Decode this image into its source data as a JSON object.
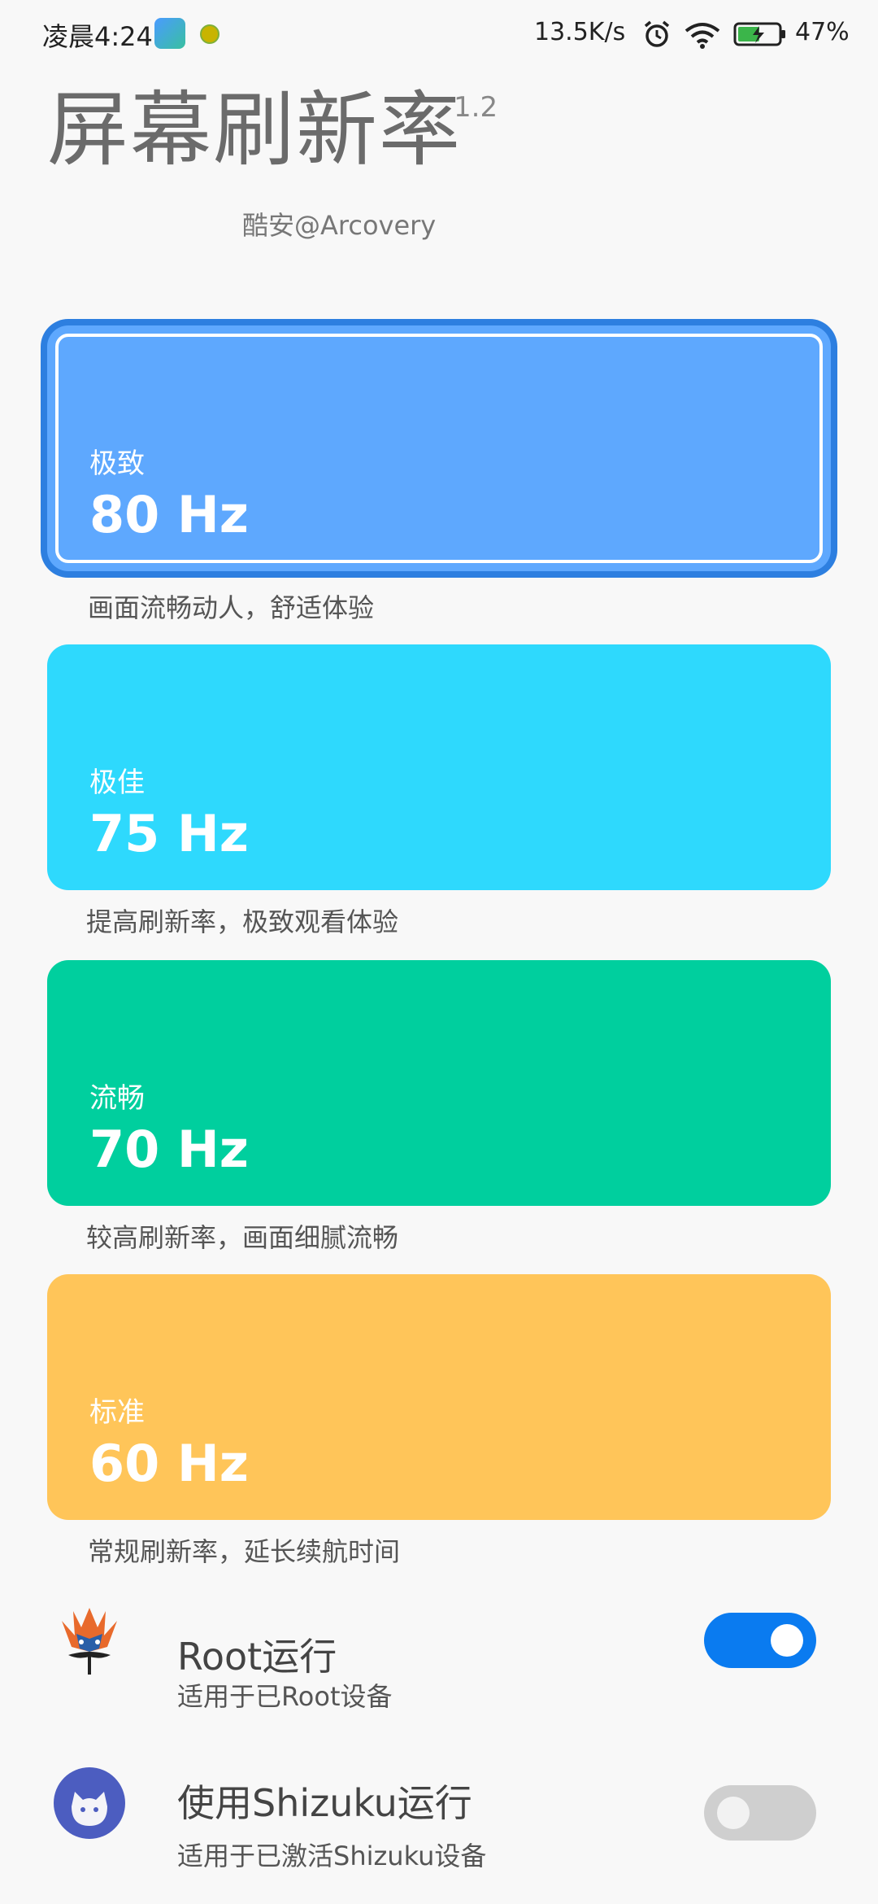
{
  "status_bar": {
    "time": "凌晨4:24",
    "net_speed": "13.5K/s",
    "battery": "47%",
    "icons": [
      "app-icon",
      "bulb-icon",
      "alarm-icon",
      "wifi-icon",
      "battery-charging-icon"
    ]
  },
  "header": {
    "title": "屏幕刷新率",
    "version": "1.2",
    "author": "酷安@Arcovery"
  },
  "rates": [
    {
      "name": "极致",
      "value": "80 Hz",
      "description": "画面流畅动人，舒适体验",
      "color": "#5ea8fe",
      "selected": true
    },
    {
      "name": "极佳",
      "value": "75 Hz",
      "description": "提高刷新率，极致观看体验",
      "color": "#2ed9fd",
      "selected": false
    },
    {
      "name": "流畅",
      "value": "70 Hz",
      "description": "较高刷新率，画面细腻流畅",
      "color": "#00cf9e",
      "selected": false
    },
    {
      "name": "标准",
      "value": "60 Hz",
      "description": "常规刷新率，延长续航时间",
      "color": "#ffc559",
      "selected": false
    }
  ],
  "settings": {
    "root": {
      "title": "Root运行",
      "subtitle": "适用于已Root设备",
      "enabled": true,
      "icon": "magisk-icon"
    },
    "shizuku": {
      "title": "使用Shizuku运行",
      "subtitle": "适用于已激活Shizuku设备",
      "enabled": false,
      "icon": "shizuku-icon"
    }
  },
  "colors": {
    "selected_border": "#2d7fe0",
    "toggle_on": "#0a7bf0",
    "toggle_off": "#cfcfcf"
  }
}
